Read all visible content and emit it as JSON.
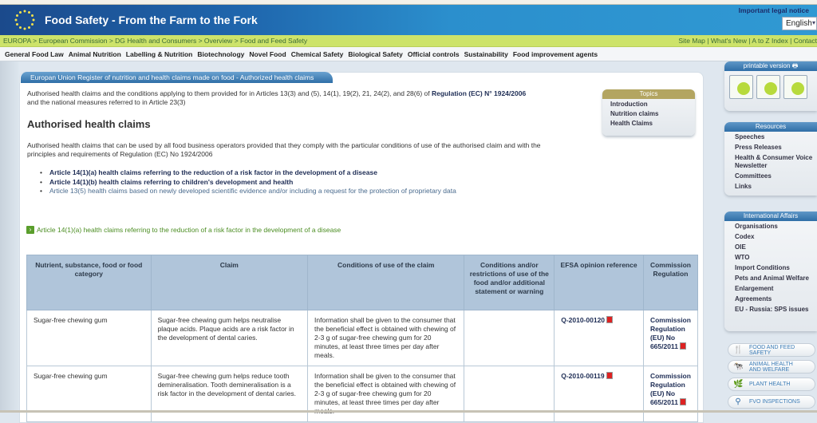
{
  "header": {
    "site_title": "Food Safety - From the Farm to the Fork",
    "legal_notice": "Important legal notice",
    "language": "English"
  },
  "breadcrumb": {
    "items": [
      "EUROPA",
      "European Commission",
      "DG Health and Consumers",
      "Overview",
      "Food and Feed Safety"
    ],
    "separator": " > "
  },
  "top_links": [
    "Site Map",
    "What's New",
    "A to Z Index",
    "Contact"
  ],
  "nav": [
    "General Food Law",
    "Animal Nutrition",
    "Labelling & Nutrition",
    "Biotechnology",
    "Novel Food",
    "Chemical Safety",
    "Biological Safety",
    "Official controls",
    "Sustainability",
    "Food improvement agents"
  ],
  "main": {
    "tab_title": "Europan Union Register of nutrition and health claims made on food - Authorized health claims",
    "intro_text": "Authorised health claims and the conditions applying to them provided for in Articles 13(3) and (5), 14(1), 19(2), 21, 24(2), and 28(6) of ",
    "intro_link": "Regulation (EC) N° 1924/2006",
    "intro_text2": "and the national measures referred to in Article 23(3)",
    "heading": "Authorised health claims",
    "description": "Authorised health claims that can be used by all food business operators provided that they comply with the particular conditions of use of the authorised claim and with the principles and requirements of Regulation (EC) No 1924/2006",
    "links": [
      "Article 14(1)(a) health claims referring to the reduction of a risk factor in the development of a disease",
      "Article 14(1)(b) health claims referring to children's development and health",
      "Article 13(5) health claims based on newly developed scientific evidence and/or including a request for the protection of proprietary data"
    ],
    "section_heading": "Article 14(1)(a) health claims referring to the reduction of a risk factor in the development of a disease"
  },
  "topics": {
    "title": "Topics",
    "items": [
      "Introduction",
      "Nutrition claims",
      "Health Claims"
    ]
  },
  "table": {
    "headers": [
      "Nutrient, substance, food or food category",
      "Claim",
      "Conditions of use of the claim",
      "Conditions and/or restrictions of use of the food and/or additional statement or warning",
      "EFSA opinion reference",
      "Commission Regulation"
    ],
    "rows": [
      {
        "nutrient": "Sugar-free chewing gum",
        "claim": "Sugar-free chewing gum helps neutralise plaque acids. Plaque acids are a risk factor in the development of dental caries.",
        "conditions": "Information shall be given to the consumer that the beneficial effect is obtained with chewing of 2-3 g of sugar-free chewing gum for 20 minutes, at least three times per day after meals.",
        "restrictions": "",
        "efsa": "Q-2010-00120",
        "regulation": "Commission Regulation (EU) No 665/2011"
      },
      {
        "nutrient": "Sugar-free chewing gum",
        "claim": "Sugar-free chewing gum helps reduce tooth demineralisation. Tooth demineralisation is a risk factor in the development of dental caries.",
        "conditions": "Information shall be given to the consumer that the beneficial effect is obtained with chewing of 2-3 g of sugar-free chewing gum for 20 minutes, at least three times per day after meals.",
        "restrictions": "",
        "efsa": "Q-2010-00119",
        "regulation": "Commission Regulation (EU) No 665/2011"
      }
    ]
  },
  "sidebar": {
    "printable": "printable version",
    "resources": {
      "title": "Resources",
      "items": [
        "Speeches",
        "Press Releases",
        "Health & Consumer Voice Newsletter",
        "Committees",
        "Links"
      ]
    },
    "international": {
      "title": "International Affairs",
      "items": [
        "Organisations",
        "Codex",
        "OIE",
        "WTO",
        "Import Conditions",
        "Pets and Animal Welfare",
        "Enlargement",
        "Agreements",
        "EU - Russia: SPS issues"
      ]
    },
    "buttons": [
      "FOOD AND FEED SAFETY",
      "ANIMAL HEALTH AND WELFARE",
      "PLANT HEALTH",
      "FVO INSPECTIONS"
    ]
  }
}
